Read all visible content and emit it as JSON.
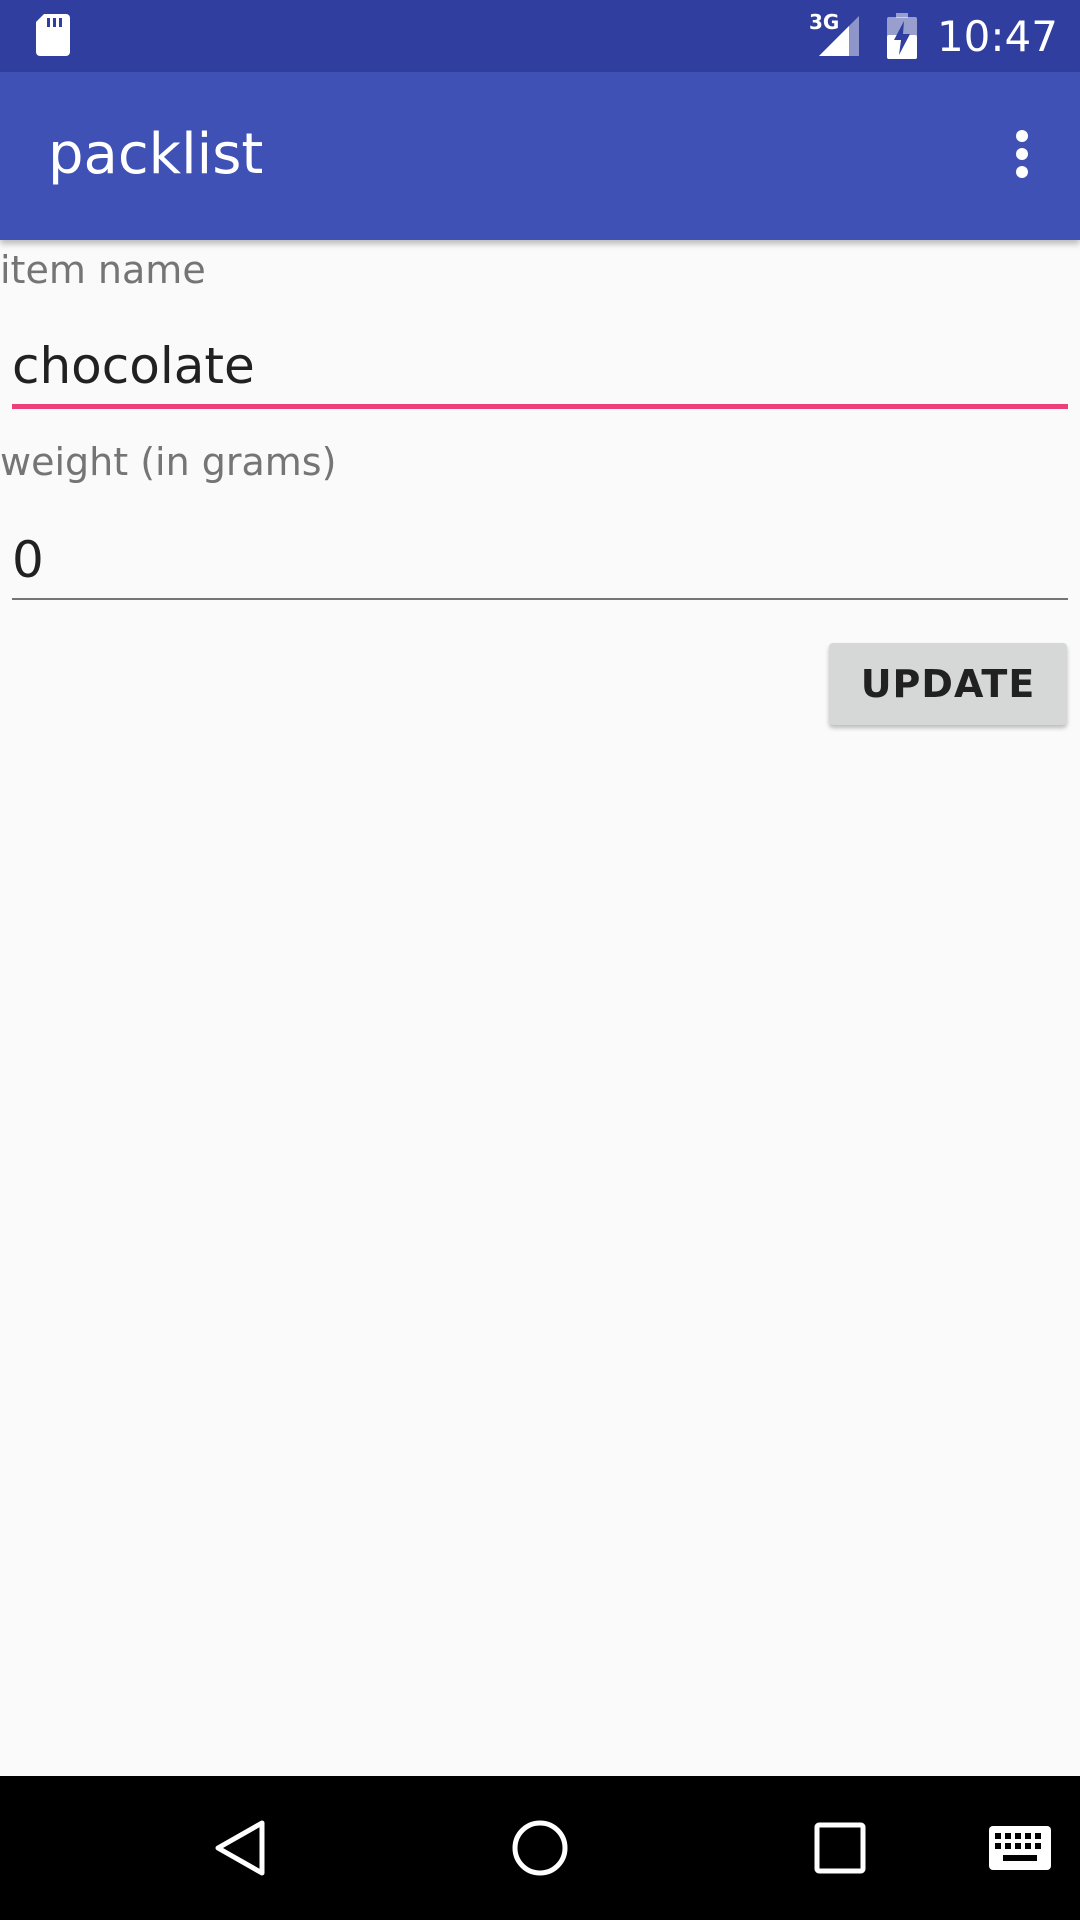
{
  "status_bar": {
    "network_label": "3G",
    "time": "10:47",
    "icons": [
      "sd-card-icon",
      "signal-icon",
      "battery-charging-icon"
    ]
  },
  "app_bar": {
    "title": "packlist",
    "overflow_icon": "more-vert-icon"
  },
  "form": {
    "item_name_label": "item name",
    "item_name_value": "chocolate",
    "weight_label": "weight (in grams)",
    "weight_value": "0",
    "update_label": "UPDATE"
  },
  "nav_bar": {
    "icons": [
      "back-icon",
      "home-icon",
      "recents-icon",
      "keyboard-icon"
    ]
  },
  "colors": {
    "status_bar": "#303f9f",
    "app_bar": "#3f51b5",
    "accent": "#ec407a",
    "background": "#fafafa",
    "button": "#d6d7d7"
  }
}
